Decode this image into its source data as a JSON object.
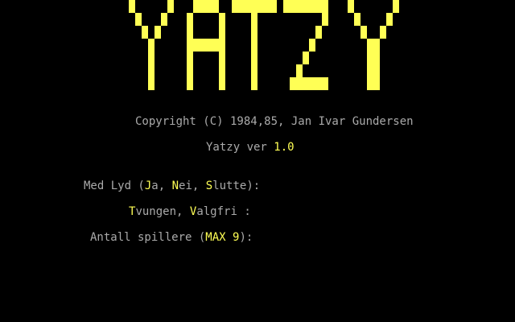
{
  "title_logo": "YATZY",
  "copyright": "Copyright (C) 1984,85, Jan Ivar Gundersen",
  "version": {
    "label": "Yatzy ver ",
    "number": "1.0"
  },
  "prompts": {
    "sound": {
      "prefix": "Med Lyd (",
      "opt1_key": "J",
      "opt1_rest": "a, ",
      "opt2_key": "N",
      "opt2_rest": "ei, ",
      "opt3_key": "S",
      "opt3_rest": "lutte",
      "suffix": "):"
    },
    "mode": {
      "opt1_key": "T",
      "opt1_rest": "vungen, ",
      "opt2_key": "V",
      "opt2_rest": "algfri",
      "suffix": " :"
    },
    "players": {
      "prefix": "Antall spillere (",
      "max": "MAX 9",
      "suffix": "):"
    }
  },
  "colors": {
    "background": "#000000",
    "text": "#aaaaaa",
    "highlight": "#ffff55"
  }
}
